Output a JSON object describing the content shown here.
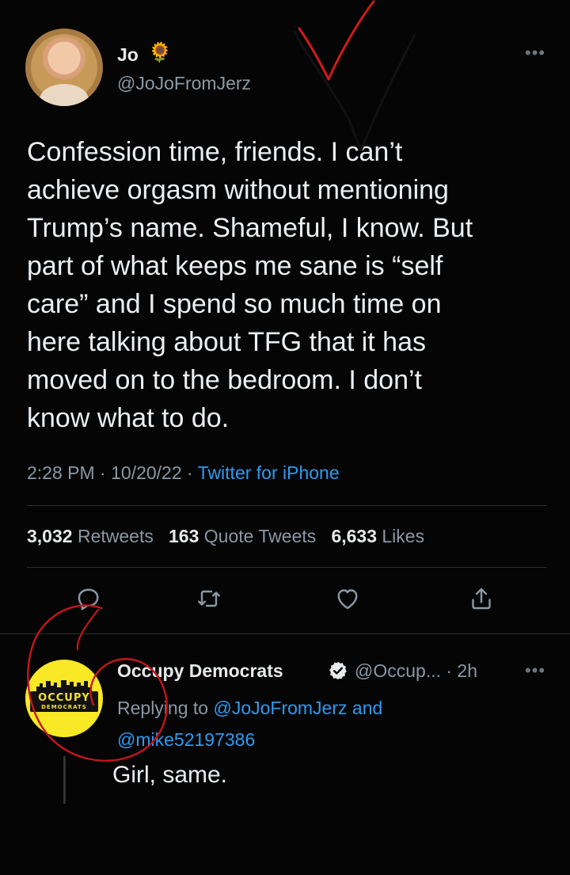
{
  "tweet": {
    "author_name": "Jo",
    "author_emoji": "🌻",
    "handle": "@JoJoFromJerz",
    "more_icon": "more-horizontal-icon",
    "text": "Confession time, friends. I can’t\nachieve orgasm without mentioning\nTrump’s name. Shameful, I know. But\npart of what keeps me sane is “self\ncare” and I spend so much time on\nhere talking about TFG that it has\nmoved on to the bedroom. I don’t\nknow what to do.",
    "time": "2:28 PM",
    "date": "10/20/22",
    "source": "Twitter for iPhone",
    "retweets_count": "3,032",
    "retweets_label": "Retweets",
    "quotes_count": "163",
    "quotes_label": "Quote Tweets",
    "likes_count": "6,633",
    "likes_label": "Likes"
  },
  "reply": {
    "author_name": "Occupy Democrats",
    "handle_time": "@Occup... · 2h",
    "avatar_text": "OCCUPY",
    "avatar_subtext": "DEMOCRATS",
    "replying_prefix": "Replying to",
    "replying_user1": "@JoJoFromJerz",
    "replying_and": "and",
    "replying_user2": "@mike52197386",
    "text": "Girl, same."
  },
  "colors": {
    "background": "#050505",
    "link": "#2f9bf0",
    "annotation_red": "#d11a1a",
    "avatar_yellow": "#f8e825"
  }
}
